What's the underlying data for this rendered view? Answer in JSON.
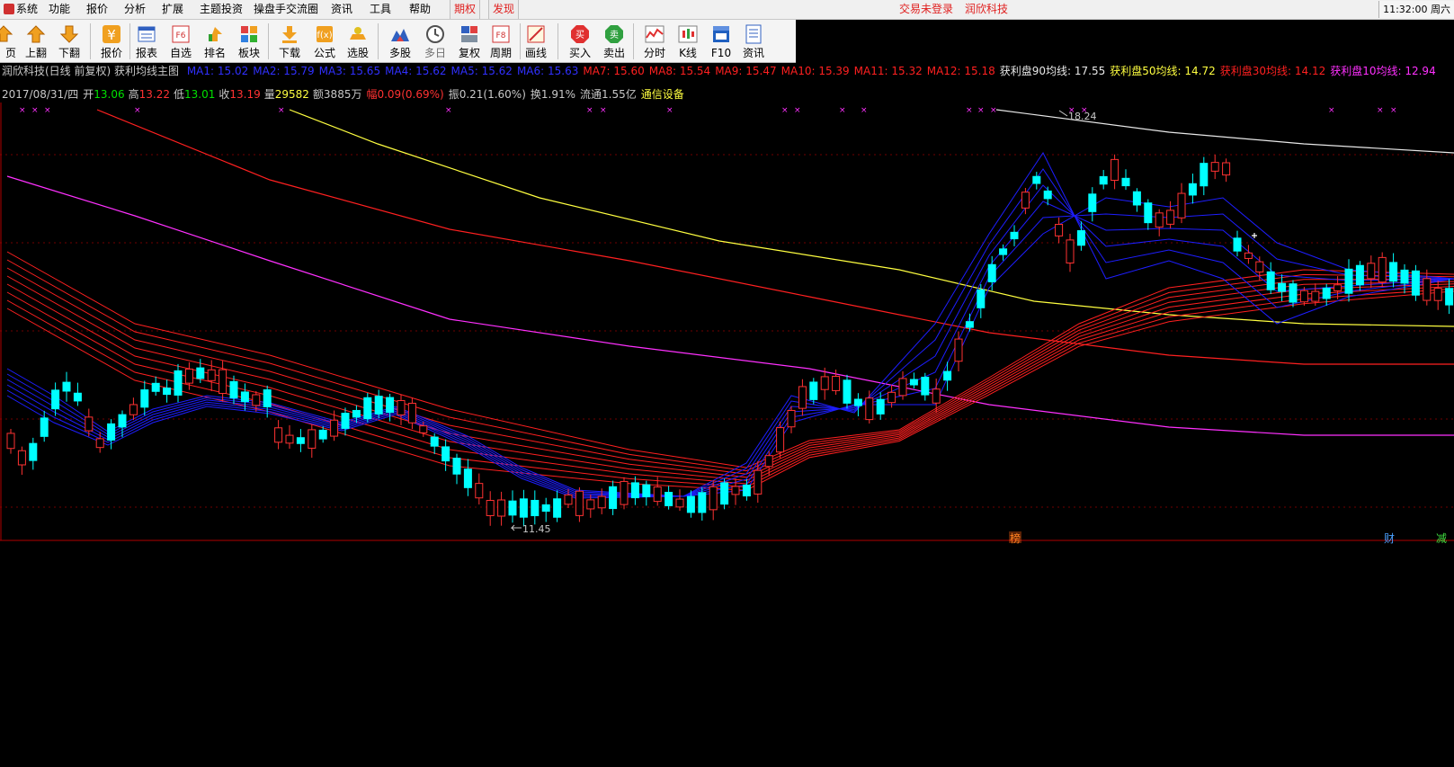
{
  "menu": {
    "items": [
      "系统",
      "功能",
      "报价",
      "分析",
      "扩展",
      "主题投资",
      "操盘手交流圈",
      "资讯",
      "工具",
      "帮助"
    ],
    "tabs": [
      "期权",
      "发现"
    ],
    "right_links": [
      "交易未登录",
      "润欣科技"
    ],
    "clock": "11:32:00 周六"
  },
  "toolbar": {
    "buttons": [
      {
        "label": "页",
        "icon": "page-icon"
      },
      {
        "label": "上翻",
        "icon": "arrow-up-icon"
      },
      {
        "label": "下翻",
        "icon": "arrow-down-icon"
      },
      {
        "label": "报价",
        "icon": "yuan-icon"
      },
      {
        "label": "报表",
        "icon": "report-icon"
      },
      {
        "label": "自选",
        "icon": "f6-icon"
      },
      {
        "label": "排名",
        "icon": "ranking-icon"
      },
      {
        "label": "板块",
        "icon": "sector-icon"
      },
      {
        "label": "下载",
        "icon": "download-icon"
      },
      {
        "label": "公式",
        "icon": "formula-icon"
      },
      {
        "label": "选股",
        "icon": "stock-pick-icon"
      },
      {
        "label": "多股",
        "icon": "multi-stock-icon"
      },
      {
        "label": "多日",
        "icon": "clock-icon"
      },
      {
        "label": "复权",
        "icon": "adjust-icon"
      },
      {
        "label": "周期",
        "icon": "f8-icon"
      },
      {
        "label": "画线",
        "icon": "draw-line-icon"
      },
      {
        "label": "买入",
        "icon": "buy-icon"
      },
      {
        "label": "卖出",
        "icon": "sell-icon"
      },
      {
        "label": "分时",
        "icon": "intraday-icon"
      },
      {
        "label": "K线",
        "icon": "kline-icon"
      },
      {
        "label": "F10",
        "icon": "f10-icon"
      },
      {
        "label": "资讯",
        "icon": "news-icon"
      }
    ]
  },
  "chart_header": {
    "title": "润欣科技(日线 前复权) 获利均线主图",
    "ma_items": [
      {
        "text": "MA1: 15.02",
        "color": "#3030ff"
      },
      {
        "text": "MA2: 15.79",
        "color": "#3030ff"
      },
      {
        "text": "MA3: 15.65",
        "color": "#3030ff"
      },
      {
        "text": "MA4: 15.62",
        "color": "#3030ff"
      },
      {
        "text": "MA5: 15.62",
        "color": "#3030ff"
      },
      {
        "text": "MA6: 15.63",
        "color": "#3030ff"
      },
      {
        "text": "MA7: 15.60",
        "color": "#ff2020"
      },
      {
        "text": "MA8: 15.54",
        "color": "#ff2020"
      },
      {
        "text": "MA9: 15.47",
        "color": "#ff2020"
      },
      {
        "text": "MA10: 15.39",
        "color": "#ff2020"
      },
      {
        "text": "MA11: 15.32",
        "color": "#ff2020"
      },
      {
        "text": "MA12: 15.18",
        "color": "#ff2020"
      },
      {
        "text": "获利盘90均线: 17.55",
        "color": "#e8e8e8"
      },
      {
        "text": "获利盘50均线: 14.72",
        "color": "#ffff40"
      },
      {
        "text": "获利盘30均线: 14.12",
        "color": "#ff2020"
      },
      {
        "text": "获利盘10均线: 12.94",
        "color": "#ff30ff"
      }
    ]
  },
  "quote": {
    "date": "2017/08/31/四",
    "open_label": "开",
    "open": "13.06",
    "high_label": "高",
    "high": "13.22",
    "low_label": "低",
    "low": "13.01",
    "close_label": "收",
    "close": "13.19",
    "vol_label": "量",
    "vol": "29582",
    "amount": "额3885万",
    "change": "幅0.09(0.69%)",
    "amplitude": "振0.21(1.60%)",
    "turnover": "换1.91%",
    "float": "流通1.55亿",
    "industry": "通信设备"
  },
  "chart_labels": {
    "high_mark": "18.24",
    "low_mark": "11.45",
    "event_bang": "榜",
    "event_cai": "财",
    "event_jian": "减"
  },
  "colors": {
    "up": "#ff3232",
    "down": "#00ffff",
    "ma_blue": "#1e1eff",
    "ma_red": "#ff2020",
    "line90": "#e8e8e8",
    "line50": "#ffff40",
    "line30": "#ff2020",
    "line10": "#ff30ff"
  },
  "chart_data": {
    "type": "line",
    "title": "润欣科技(日线 前复权) 获利均线主图",
    "series": [
      {
        "name": "获利盘90均线",
        "values": [
          17.55
        ]
      },
      {
        "name": "获利盘50均线",
        "values": [
          14.72
        ]
      },
      {
        "name": "获利盘30均线",
        "values": [
          14.12
        ]
      },
      {
        "name": "获利盘10均线",
        "values": [
          12.94
        ]
      }
    ],
    "annotations": [
      "18.24",
      "11.45"
    ]
  }
}
